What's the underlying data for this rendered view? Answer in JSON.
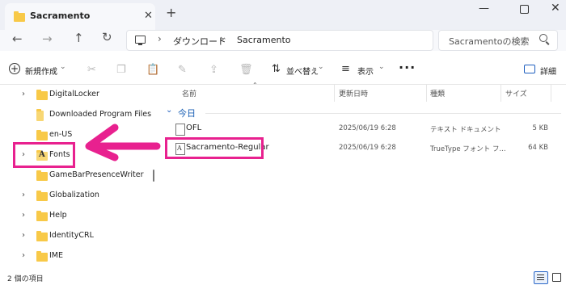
{
  "window": {
    "tab_title": "Sacramento",
    "tab_close": "✕",
    "new_tab": "+",
    "minimize": "—",
    "close": "✕"
  },
  "nav": {
    "back": "←",
    "forward": "→",
    "up": "↑",
    "refresh": "↻",
    "separator": "›",
    "breadcrumbs": [
      "ダウンロード",
      "Sacramento"
    ]
  },
  "search": {
    "placeholder": "Sacramentoの検索"
  },
  "toolbar": {
    "new_label": "新規作成",
    "new_icon": "+",
    "caret": "⌄",
    "sort_label": "並べ替え",
    "sort_icon": "⇅",
    "view_label": "表示",
    "view_icon": "≡",
    "more": "···",
    "details_label": "詳細",
    "icons": {
      "cut": "✂",
      "copy": "❐",
      "paste": "📋",
      "rename": "✎",
      "share": "⇪",
      "delete": "🗑"
    }
  },
  "sidebar": {
    "chevron": "›",
    "items": [
      {
        "label": "DigitalLocker",
        "expandable": true
      },
      {
        "label": "Downloaded Program Files",
        "expandable": false
      },
      {
        "label": "en-US",
        "expandable": false
      },
      {
        "label": "Fonts",
        "expandable": true,
        "icon": "fonts-folder-icon"
      },
      {
        "label": "GameBarPresenceWriter",
        "expandable": false
      },
      {
        "label": "Globalization",
        "expandable": true
      },
      {
        "label": "Help",
        "expandable": true
      },
      {
        "label": "IdentityCRL",
        "expandable": true
      },
      {
        "label": "IME",
        "expandable": true
      }
    ]
  },
  "file_list": {
    "columns": [
      "名前",
      "更新日時",
      "種類",
      "サイズ"
    ],
    "sort_indicator": "⌃",
    "group_label": "今日",
    "group_chevron": "⌄",
    "rows": [
      {
        "name": "OFL",
        "modified": "2025/06/19 6:28",
        "type": "テキスト ドキュメント",
        "size": "5 KB"
      },
      {
        "name": "Sacramento-Regular",
        "modified": "2025/06/19 6:28",
        "type": "TrueType フォント フ...",
        "size": "64 KB"
      }
    ]
  },
  "status": {
    "item_count": "2 個の項目"
  },
  "colors": {
    "highlight": "#e8218f",
    "accent": "#1a5fb4",
    "folder": "#f8c948"
  }
}
